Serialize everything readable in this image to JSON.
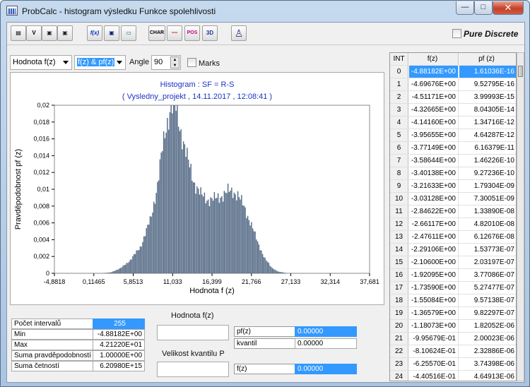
{
  "window": {
    "title": "ProbCalc - histogram  výsledku Funkce spolehlivosti",
    "min_label": "—",
    "max_label": "□",
    "close_label": "✕"
  },
  "toolbar": {
    "items": [
      {
        "name": "page-icon",
        "glyph": "▤"
      },
      {
        "name": "v-icon",
        "glyph": "V"
      },
      {
        "name": "save-icon",
        "glyph": "▣"
      },
      {
        "name": "save-as-icon",
        "glyph": "▣"
      },
      {
        "name": "formula-icon",
        "glyph": "f(x)"
      },
      {
        "name": "disk-icon",
        "glyph": "▣"
      },
      {
        "name": "rectangle-icon",
        "glyph": "▭"
      },
      {
        "name": "char-icon",
        "glyph": "CHAR"
      },
      {
        "name": "wave-icon",
        "glyph": "〰"
      },
      {
        "name": "pos-icon",
        "glyph": "POS"
      },
      {
        "name": "3d-icon",
        "glyph": "3D"
      },
      {
        "name": "person-icon",
        "glyph": "♙"
      }
    ],
    "pure_discrete_label": "Pure Discrete"
  },
  "controls": {
    "variable": "Hodnota f(z)",
    "mode": "f(z) & pf(z)",
    "angle_label": "Angle",
    "angle_value": "90",
    "marks_label": "Marks"
  },
  "chart_data": {
    "type": "bar",
    "title": "Histogram : SF = R-S",
    "subtitle": "( Vysledny_projekt , 14.11.2017 , 12:08:41 )",
    "xlabel": "Hodnota   f (z)",
    "ylabel": "Pravděpodobnost   pf (z)",
    "xlim": [
      -4.8818,
      42.122
    ],
    "ylim": [
      0,
      0.02
    ],
    "x_ticks": [
      "-4,8818",
      "0,11465",
      "5,8513",
      "11,033",
      "16,399",
      "21,766",
      "27,133",
      "32,314",
      "37,681"
    ],
    "y_ticks": [
      "0",
      "0,002",
      "0,004",
      "0,006",
      "0,008",
      "0,01",
      "0,012",
      "0,014",
      "0,016",
      "0,018",
      "0,02"
    ],
    "bar_color": "#556b86",
    "bins": {
      "count": 255,
      "x_start": -4.8818,
      "bin_width": 0.18435
    },
    "envelope": [
      [
        -4.9,
        0
      ],
      [
        2.0,
        0
      ],
      [
        3.5,
        0.0001
      ],
      [
        5.0,
        0.0006
      ],
      [
        6.5,
        0.0016
      ],
      [
        8.0,
        0.0032
      ],
      [
        9.5,
        0.0065
      ],
      [
        10.5,
        0.0105
      ],
      [
        11.2,
        0.0145
      ],
      [
        11.8,
        0.0175
      ],
      [
        12.3,
        0.0193
      ],
      [
        12.8,
        0.02
      ],
      [
        13.3,
        0.0195
      ],
      [
        14.0,
        0.017
      ],
      [
        15.0,
        0.0135
      ],
      [
        16.0,
        0.0108
      ],
      [
        17.0,
        0.0093
      ],
      [
        18.0,
        0.0088
      ],
      [
        19.0,
        0.0088
      ],
      [
        20.0,
        0.0092
      ],
      [
        21.0,
        0.0097
      ],
      [
        21.8,
        0.0098
      ],
      [
        22.5,
        0.0093
      ],
      [
        23.5,
        0.0078
      ],
      [
        24.5,
        0.0058
      ],
      [
        25.5,
        0.0036
      ],
      [
        26.5,
        0.0018
      ],
      [
        27.5,
        0.0007
      ],
      [
        28.5,
        0.0002
      ],
      [
        30.0,
        0
      ],
      [
        42.1,
        0
      ]
    ]
  },
  "stats": {
    "header_col": "Počet intervalů",
    "header_val": "255",
    "rows": [
      {
        "label": "Min",
        "value": "-4.88182E+00"
      },
      {
        "label": "Max",
        "value": "4.21220E+01"
      },
      {
        "label": "Suma pravděpodobností",
        "value": "1.00000E+00"
      },
      {
        "label": "Suma četností",
        "value": "6.20980E+15"
      }
    ]
  },
  "inputs": {
    "value_label": "Hodnota f(z)",
    "value_input": "",
    "pf_label": "pf(z)",
    "pf_value": "0.00000",
    "kvantil_label": "kvantil",
    "kvantil_value": "0.00000",
    "quantile_label": "Velikost kvantilu P",
    "quantile_input": "",
    "fz_label": "f(z)",
    "fz_value": "0.00000"
  },
  "table": {
    "headers": [
      "INT",
      "f(z)",
      "pf (z)"
    ],
    "rows": [
      [
        "0",
        "-4.88182E+00",
        "1.61036E-16"
      ],
      [
        "1",
        "-4.69676E+00",
        "9.52795E-16"
      ],
      [
        "2",
        "-4.51171E+00",
        "3.99993E-15"
      ],
      [
        "3",
        "-4.32665E+00",
        "8.04305E-14"
      ],
      [
        "4",
        "-4.14160E+00",
        "1.34716E-12"
      ],
      [
        "5",
        "-3.95655E+00",
        "4.64287E-12"
      ],
      [
        "6",
        "-3.77149E+00",
        "6.16379E-11"
      ],
      [
        "7",
        "-3.58644E+00",
        "1.46226E-10"
      ],
      [
        "8",
        "-3.40138E+00",
        "9.27236E-10"
      ],
      [
        "9",
        "-3.21633E+00",
        "1.79304E-09"
      ],
      [
        "10",
        "-3.03128E+00",
        "7.30051E-09"
      ],
      [
        "11",
        "-2.84622E+00",
        "1.33890E-08"
      ],
      [
        "12",
        "-2.66117E+00",
        "4.82010E-08"
      ],
      [
        "13",
        "-2.47611E+00",
        "6.12676E-08"
      ],
      [
        "14",
        "-2.29106E+00",
        "1.53773E-07"
      ],
      [
        "15",
        "-2.10600E+00",
        "2.03197E-07"
      ],
      [
        "16",
        "-1.92095E+00",
        "3.77086E-07"
      ],
      [
        "17",
        "-1.73590E+00",
        "5.27477E-07"
      ],
      [
        "18",
        "-1.55084E+00",
        "9.57138E-07"
      ],
      [
        "19",
        "-1.36579E+00",
        "9.82297E-07"
      ],
      [
        "20",
        "-1.18073E+00",
        "1.82052E-06"
      ],
      [
        "21",
        "-9.95679E-01",
        "2.00023E-06"
      ],
      [
        "22",
        "-8.10624E-01",
        "2.32886E-06"
      ],
      [
        "23",
        "-6.25570E-01",
        "3.74398E-06"
      ],
      [
        "24",
        "-4.40516E-01",
        "4.64913E-06"
      ]
    ]
  }
}
